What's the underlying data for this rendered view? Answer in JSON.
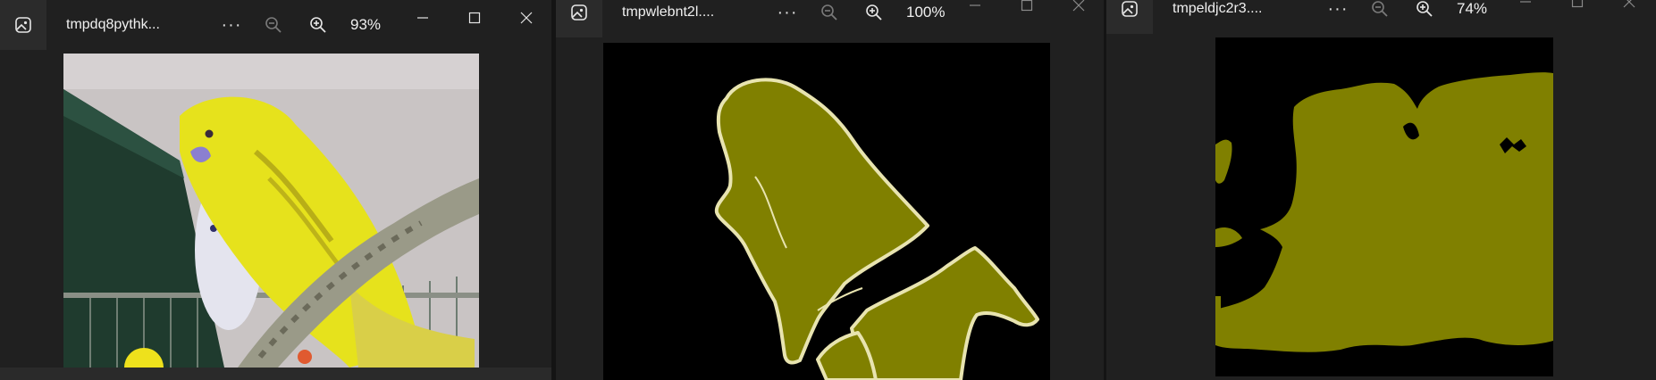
{
  "colors": {
    "window_bg": "#202020",
    "mask_fill": "#808000",
    "mask_outline": "#e8e4b0",
    "mask_bg": "#000000"
  },
  "windows": [
    {
      "title": "tmpdq8pythk...",
      "zoom": "93%",
      "icons": [
        "image-app-icon",
        "more-options-icon",
        "zoom-out-icon",
        "zoom-in-icon",
        "minimize-icon",
        "maximize-icon",
        "close-icon"
      ],
      "content": "photo of yellow budgie on perch"
    },
    {
      "title": "tmpwlebnt2l....",
      "zoom": "100%",
      "icons": [
        "image-app-icon",
        "more-options-icon",
        "zoom-out-icon",
        "zoom-in-icon",
        "minimize-icon",
        "maximize-icon",
        "close-icon"
      ],
      "content": "segmentation mask with outline"
    },
    {
      "title": "tmpeldjc2r3....",
      "zoom": "74%",
      "icons": [
        "image-app-icon",
        "more-options-icon",
        "zoom-out-icon",
        "zoom-in-icon",
        "minimize-icon",
        "maximize-icon",
        "close-icon"
      ],
      "content": "segmentation mask coarse"
    }
  ]
}
